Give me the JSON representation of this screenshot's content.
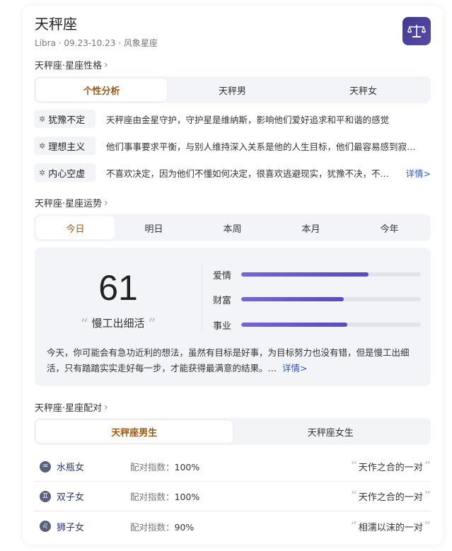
{
  "header": {
    "title": "天秤座",
    "subtitle": "Libra · 09.23-10.23 · 风象星座"
  },
  "personality": {
    "section_title": "天秤座·星座性格",
    "tabs": [
      "个性分析",
      "天秤男",
      "天秤女"
    ],
    "traits": [
      {
        "tag": "犹豫不定",
        "text": "天秤座由金星守护，守护星是维纳斯，影响他们爱好追求和平和谐的感觉"
      },
      {
        "tag": "理想主义",
        "text": "他们事事要求平衡，与别人维持深入关系是他的人生目标，他们最容易感到寂…"
      },
      {
        "tag": "内心空虚",
        "text": "不喜欢决定，因为他们不懂如何决定，很喜欢逃避现实，犹豫不决，不…"
      }
    ],
    "more": "详情>"
  },
  "fortune": {
    "section_title": "天秤座·星座运势",
    "tabs": [
      "今日",
      "明日",
      "本周",
      "本月",
      "今年"
    ],
    "score": "61",
    "motto": "慢工出细活",
    "bars": [
      {
        "label": "爱情",
        "value": 0.71
      },
      {
        "label": "财富",
        "value": 0.57
      },
      {
        "label": "事业",
        "value": 0.59
      }
    ],
    "text": "今天，你可能会有急功近利的想法，虽然有目标是好事，为目标努力也没有错，但是慢工出细活，只有踏踏实实走好每一步，才能获得最满意的结果。…",
    "more": "详情>"
  },
  "match": {
    "section_title": "天秤座·星座配对",
    "tabs": [
      "天秤座男生",
      "天秤座女生"
    ],
    "index_label": "配对指数：",
    "rows": [
      {
        "icon": "aquarius-icon",
        "glyph": "♒",
        "name": "水瓶女",
        "index": "100%",
        "desc": "天作之合的一对"
      },
      {
        "icon": "gemini-icon",
        "glyph": "♊",
        "name": "双子女",
        "index": "100%",
        "desc": "天作之合的一对"
      },
      {
        "icon": "leo-icon",
        "glyph": "♌",
        "name": "狮子女",
        "index": "90%",
        "desc": "相濡以沫的一对"
      }
    ]
  },
  "colors": {
    "accent": "#9a5b16",
    "link": "#2b55c6",
    "bar": "#6b5ad0",
    "badge": "#4a43a0"
  }
}
